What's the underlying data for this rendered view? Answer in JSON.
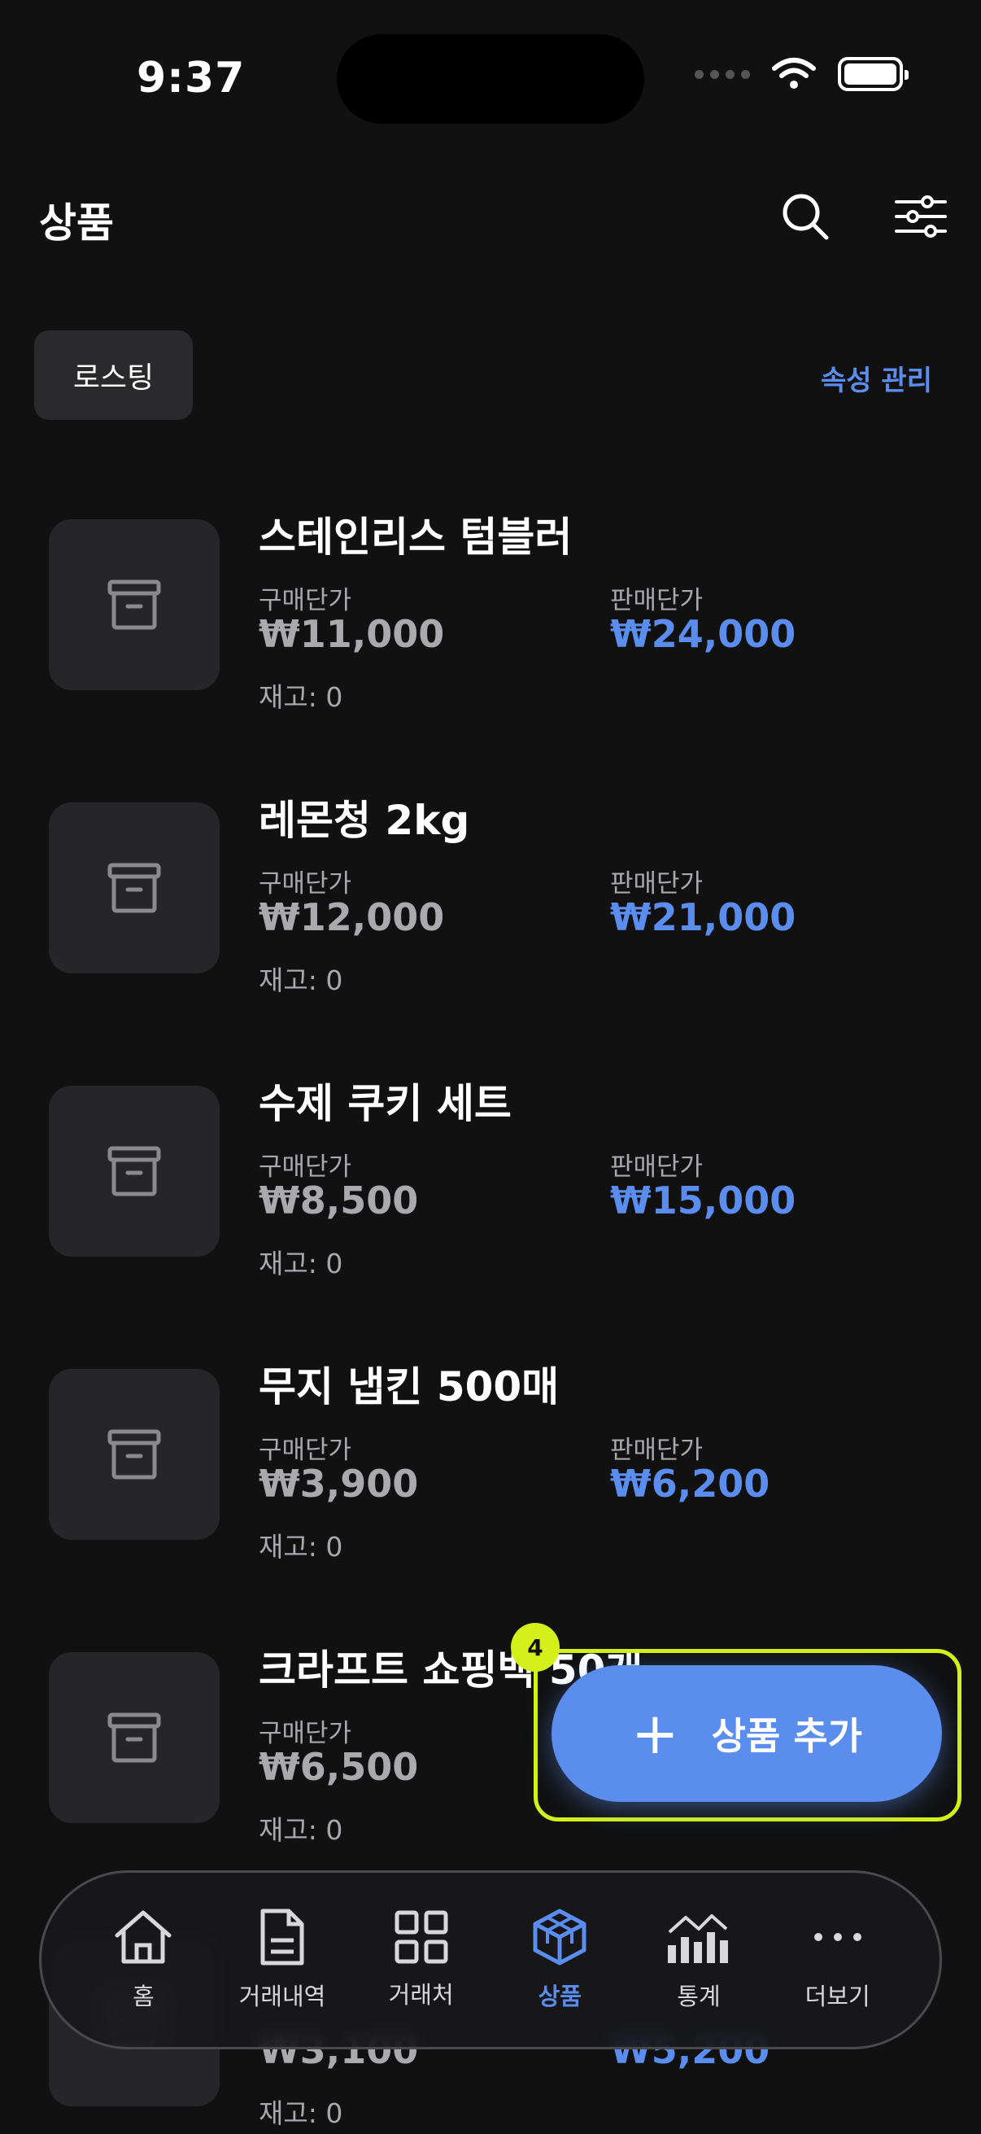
{
  "status_bar": {
    "time": "9:37"
  },
  "header": {
    "title": "상품"
  },
  "filter": {
    "chip_label": "로스팅",
    "manage_attributes_label": "속성 관리"
  },
  "labels": {
    "buy_price": "구매단가",
    "sell_price": "판매단가"
  },
  "products": [
    {
      "name": "스테인리스 텀블러",
      "buy": "₩11,000",
      "sell": "₩24,000",
      "stock": "재고: 0"
    },
    {
      "name": "레몬청 2kg",
      "buy": "₩12,000",
      "sell": "₩21,000",
      "stock": "재고: 0"
    },
    {
      "name": "수제 쿠키 세트",
      "buy": "₩8,500",
      "sell": "₩15,000",
      "stock": "재고: 0"
    },
    {
      "name": "무지 냅킨 500매",
      "buy": "₩3,900",
      "sell": "₩6,200",
      "stock": "재고: 0"
    },
    {
      "name": "크라프트 쇼핑백 50개",
      "buy": "₩6,500",
      "sell": "",
      "stock": "재고: 0"
    },
    {
      "name": "",
      "buy": "₩3,100",
      "sell": "₩5,200",
      "stock": "재고: 0"
    }
  ],
  "fab": {
    "label": "상품 추가",
    "badge": "4"
  },
  "tabbar": {
    "items": [
      {
        "label": "홈",
        "icon": "home-icon"
      },
      {
        "label": "거래내역",
        "icon": "document-icon"
      },
      {
        "label": "거래처",
        "icon": "grid-icon"
      },
      {
        "label": "상품",
        "icon": "cube-icon",
        "active": true
      },
      {
        "label": "통계",
        "icon": "chart-icon"
      },
      {
        "label": "더보기",
        "icon": "more-icon"
      }
    ]
  },
  "colors": {
    "accent": "#5b8def",
    "highlight": "#d4f01a",
    "background": "#111112"
  }
}
